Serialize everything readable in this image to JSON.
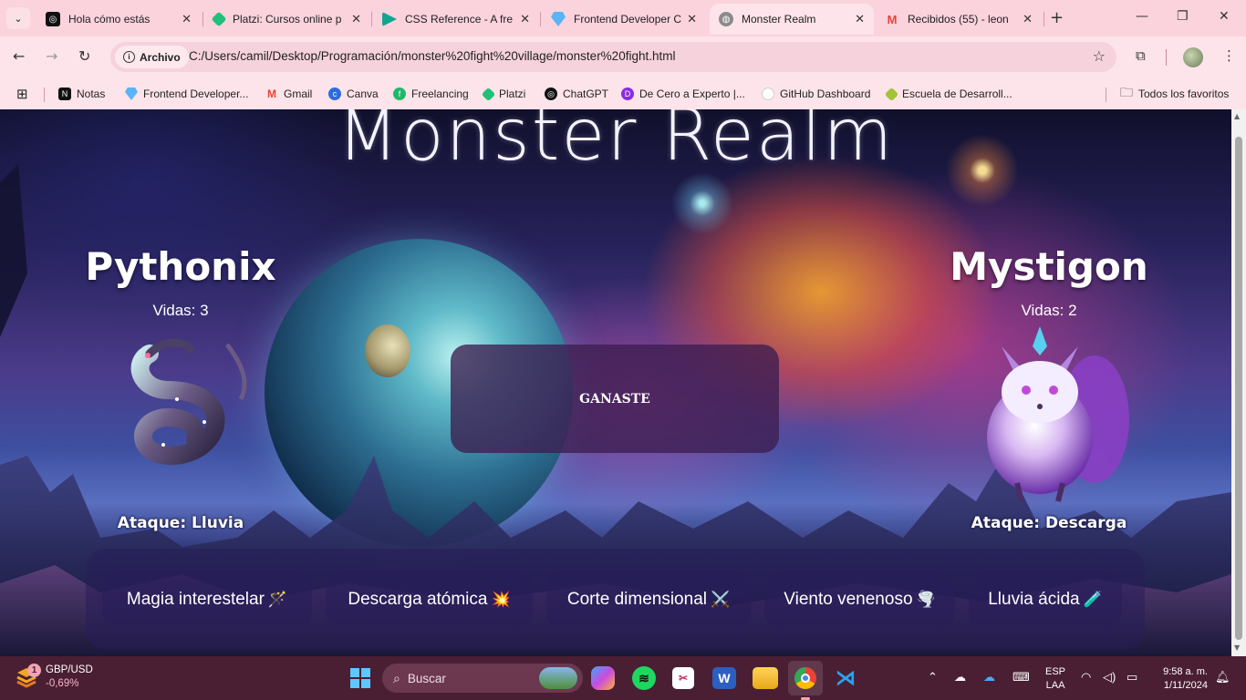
{
  "browser": {
    "tabs": [
      {
        "title": "Hola cómo estás",
        "icon": "chatgpt-icon",
        "color": "#111111"
      },
      {
        "title": "Platzi: Cursos online p",
        "icon": "platzi-icon",
        "color": "#21c07a"
      },
      {
        "title": "CSS Reference - A fre",
        "icon": "css-reference-icon",
        "color": "#12a58f"
      },
      {
        "title": "Frontend Developer C",
        "icon": "diamond-icon",
        "color": "#5ab4f5"
      },
      {
        "title": "Monster Realm",
        "icon": "globe-icon",
        "color": "#8a8a8a",
        "active": true
      },
      {
        "title": "Recibidos (55) - leon",
        "icon": "gmail-icon",
        "color": "#ea4335"
      }
    ],
    "new_tab": "+",
    "address": {
      "chip": "Archivo",
      "url": "C:/Users/camil/Desktop/Programación/monster%20fight%20village/monster%20fight.html"
    },
    "bookmarks": [
      {
        "label": "Notas",
        "icon": "notion-icon",
        "color": "#111111"
      },
      {
        "label": "Frontend Developer...",
        "icon": "diamond-icon",
        "color": "#5ab4f5"
      },
      {
        "label": "Gmail",
        "icon": "gmail-icon",
        "color": "#ea4335"
      },
      {
        "label": "Canva",
        "icon": "canva-icon",
        "color": "#2d6cdf"
      },
      {
        "label": "Freelancing",
        "icon": "freelancing-icon",
        "color": "#1db96b"
      },
      {
        "label": "Platzi",
        "icon": "platzi-icon",
        "color": "#21c07a"
      },
      {
        "label": "ChatGPT",
        "icon": "chatgpt-icon",
        "color": "#111111"
      },
      {
        "label": "De Cero a Experto |...",
        "icon": "course-icon",
        "color": "#8a2be2"
      },
      {
        "label": "GitHub Dashboard",
        "icon": "github-icon",
        "color": "#ffffff"
      },
      {
        "label": "Escuela de Desarroll...",
        "icon": "platzi-icon",
        "color": "#a3c436"
      }
    ],
    "all_bookmarks": "Todos los favoritos"
  },
  "game": {
    "title": "Monster Realm",
    "player": {
      "name": "Pythonix",
      "lives": "Vidas: 3",
      "attack": "Ataque: Lluvia"
    },
    "enemy": {
      "name": "Mystigon",
      "lives": "Vidas: 2",
      "attack": "Ataque: Descarga"
    },
    "result": "GANASTE",
    "attacks": [
      {
        "label": "Magia interestelar",
        "emoji": "🪄"
      },
      {
        "label": "Descarga atómica",
        "emoji": "💥"
      },
      {
        "label": "Corte dimensional",
        "emoji": "⚔️"
      },
      {
        "label": "Viento venenoso",
        "emoji": "🌪️"
      },
      {
        "label": "Lluvia ácida",
        "emoji": "🧪"
      }
    ]
  },
  "taskbar": {
    "widget": {
      "badge": "1",
      "pair": "GBP/USD",
      "change": "-0,69%"
    },
    "search_placeholder": "Buscar",
    "language": {
      "line1": "ESP",
      "line2": "LAA"
    },
    "clock": {
      "time": "9:58 a. m.",
      "date": "1/11/2024"
    }
  }
}
